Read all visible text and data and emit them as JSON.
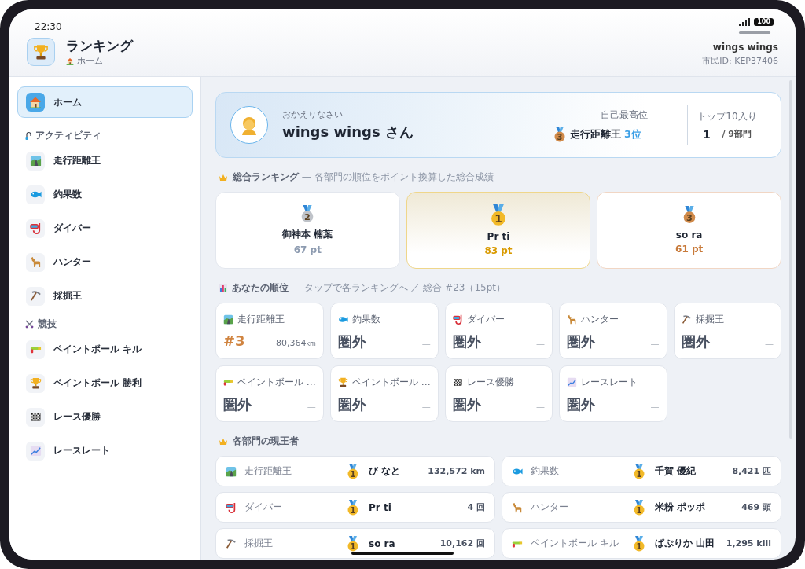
{
  "status_bar": {
    "time": "22:30",
    "battery": "100"
  },
  "header": {
    "title": "ランキング",
    "breadcrumb": "ホーム",
    "user_name": "wings wings",
    "citizen_id": "市民ID: KEP37406"
  },
  "sidebar": {
    "items": [
      {
        "label": "ホーム",
        "selected": true
      }
    ],
    "sections": [
      {
        "title": "アクティビティ",
        "items": [
          {
            "label": "走行距離王",
            "selected": false
          },
          {
            "label": "釣果数",
            "selected": false
          },
          {
            "label": "ダイバー",
            "selected": false
          },
          {
            "label": "ハンター",
            "selected": false
          },
          {
            "label": "採掘王",
            "selected": false
          }
        ]
      },
      {
        "title": "競技",
        "items": [
          {
            "label": "ペイントボール キル",
            "selected": false
          },
          {
            "label": "ペイントボール 勝利",
            "selected": false
          },
          {
            "label": "レース優勝",
            "selected": false
          },
          {
            "label": "レースレート",
            "selected": false
          }
        ]
      }
    ]
  },
  "welcome": {
    "greeting": "おかえりなさい",
    "name": "wings wings さん",
    "best_label": "自己最高位",
    "best_medal": "3",
    "best_category": "走行距離王",
    "best_rank": "3位",
    "top10_label": "トップ10入り",
    "top10_count": "1",
    "top10_total": "/ 9部門"
  },
  "overall": {
    "title": "総合ランキング",
    "subtitle": "— 各部門の順位をポイント換算した総合成績",
    "podium": [
      {
        "kind": "silver",
        "medal": "2",
        "name": "御神本 楠葉",
        "points": "67 pt"
      },
      {
        "kind": "gold",
        "medal": "1",
        "name": "Pr ti",
        "points": "83 pt"
      },
      {
        "kind": "bronze",
        "medal": "3",
        "name": "so ra",
        "points": "61 pt"
      }
    ]
  },
  "my_ranks": {
    "title": "あなたの順位",
    "subtitle": "— タップで各ランキングへ ／ 総合 #23（15pt）",
    "cards": [
      {
        "label": "走行距離王",
        "kind": "ranked",
        "rank": "#3",
        "value": "80,364",
        "unit": "km"
      },
      {
        "label": "釣果数",
        "kind": "unranked",
        "rank": "圏外",
        "value": "—"
      },
      {
        "label": "ダイバー",
        "kind": "unranked",
        "rank": "圏外",
        "value": "—"
      },
      {
        "label": "ハンター",
        "kind": "unranked",
        "rank": "圏外",
        "value": "—"
      },
      {
        "label": "採掘王",
        "kind": "unranked",
        "rank": "圏外",
        "value": "—"
      },
      {
        "label": "ペイントボール …",
        "kind": "unranked",
        "rank": "圏外",
        "value": "—"
      },
      {
        "label": "ペイントボール …",
        "kind": "unranked",
        "rank": "圏外",
        "value": "—"
      },
      {
        "label": "レース優勝",
        "kind": "unranked",
        "rank": "圏外",
        "value": "—"
      },
      {
        "label": "レースレート",
        "kind": "unranked",
        "rank": "圏外",
        "value": "—"
      }
    ]
  },
  "champions": {
    "title": "各部門の現王者",
    "rows": [
      {
        "category": "走行距離王",
        "medal": "1",
        "name": "び なと",
        "record": "132,572 km"
      },
      {
        "category": "釣果数",
        "medal": "1",
        "name": "千賀 優紀",
        "record": "8,421 匹"
      },
      {
        "category": "ダイバー",
        "medal": "1",
        "name": "Pr ti",
        "record": "4 回"
      },
      {
        "category": "ハンター",
        "medal": "1",
        "name": "米粉 ポッポ",
        "record": "469 頭"
      },
      {
        "category": "採掘王",
        "medal": "1",
        "name": "so ra",
        "record": "10,162 回"
      },
      {
        "category": "ペイントボール キル",
        "medal": "1",
        "name": "ぱぷりか 山田",
        "record": "1,295 kill"
      }
    ]
  }
}
